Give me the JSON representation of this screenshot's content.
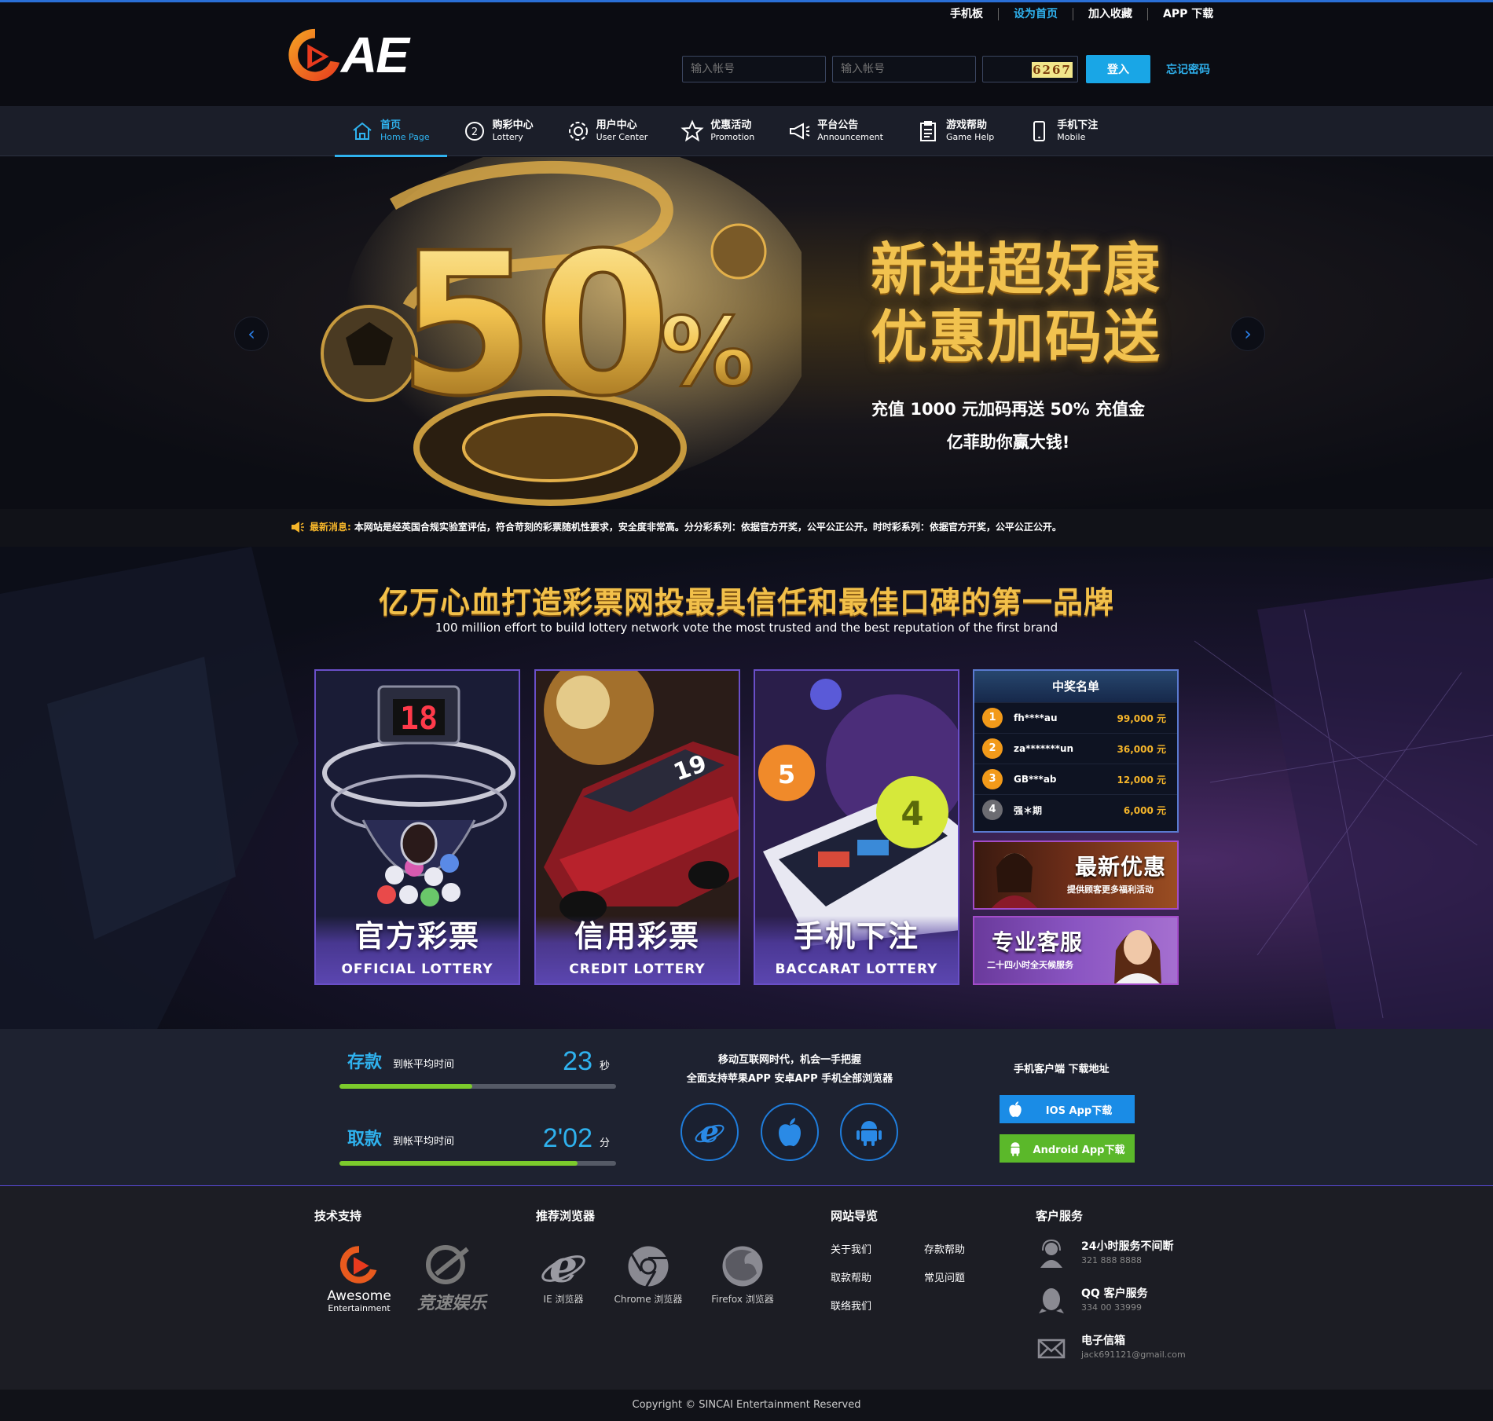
{
  "top_links": [
    "手机板",
    "设为首页",
    "加入收藏",
    "APP 下载"
  ],
  "brand": {
    "logo_text": "AE"
  },
  "login": {
    "account_placeholder": "输入帐号",
    "password_placeholder": "输入帐号",
    "captcha": "6267",
    "submit_label": "登入",
    "forgot_label": "忘记密码"
  },
  "nav": [
    {
      "zh": "首页",
      "en": "Home Page",
      "icon": "home-icon",
      "active": true
    },
    {
      "zh": "购彩中心",
      "en": "Lottery",
      "icon": "lottery-icon"
    },
    {
      "zh": "用户中心",
      "en": "User Center",
      "icon": "gear-icon"
    },
    {
      "zh": "优惠活动",
      "en": "Promotion",
      "icon": "star-icon"
    },
    {
      "zh": "平台公告",
      "en": "Announcement",
      "icon": "megaphone-icon"
    },
    {
      "zh": "游戏帮助",
      "en": "Game Help",
      "icon": "clipboard-icon"
    },
    {
      "zh": "手机下注",
      "en": "Mobile",
      "icon": "phone-icon"
    }
  ],
  "banner": {
    "big_number": "50",
    "percent": "%",
    "title_line1": "新进超好康",
    "title_line2": "优惠加码送",
    "sub_line1": "充值 1000 元加码再送 50% 充值金",
    "sub_line2": "亿菲助你赢大钱!"
  },
  "news": {
    "label": "最新消息:",
    "text": "本网站是经英国合规实验室评估，符合苛刻的彩票随机性要求，安全度非常高。分分彩系列：依据官方开奖，公平公正公开。时时彩系列：依据官方开奖，公平公正公开。"
  },
  "headline": {
    "zh": "亿万心血打造彩票网投最具信任和最佳口碑的第一品牌",
    "en": "100 million effort to build lottery network vote the most trusted and the best reputation of the first brand"
  },
  "cards": [
    {
      "zh": "官方彩票",
      "en": "OFFICIAL  LOTTERY",
      "display": "18"
    },
    {
      "zh": "信用彩票",
      "en": "CREDIT  LOTTERY"
    },
    {
      "zh": "手机下注",
      "en": "BACCARAT  LOTTERY"
    }
  ],
  "winners": {
    "title": "中奖名单",
    "rows": [
      {
        "rank": "1",
        "name": "fh****au",
        "amount": "99,000 元"
      },
      {
        "rank": "2",
        "name": "za*******un",
        "amount": "36,000 元"
      },
      {
        "rank": "3",
        "name": "GB***ab",
        "amount": "12,000 元"
      },
      {
        "rank": "4",
        "name": "强＊期",
        "amount": "6,000 元"
      }
    ]
  },
  "promos": [
    {
      "title": "最新优惠",
      "sub": "提供顾客更多福利活动"
    },
    {
      "title": "专业客服",
      "sub": "二十四小时全天候服务"
    }
  ],
  "stats": [
    {
      "title": "存款",
      "label": "到帐平均时间",
      "value": "23",
      "unit": "秒",
      "progress": 0.48
    },
    {
      "title": "取款",
      "label": "到帐平均时间",
      "value": "2'02",
      "unit": "分",
      "progress": 0.86
    }
  ],
  "mobile": {
    "line1": "移动互联网时代，机会一手把握",
    "line2": "全面支持苹果APP 安卓APP 手机全部浏览器"
  },
  "download": {
    "title": "手机客户端  下载地址",
    "ios": "IOS App下载",
    "android": "Android App下载"
  },
  "footer": {
    "tech_title": "技术支持",
    "tech_logos": [
      "Awesome",
      "Entertainment",
      "竞速娱乐"
    ],
    "browser_title": "推荐浏览器",
    "browsers": [
      "IE 浏览器",
      "Chrome 浏览器",
      "Firefox 浏览器"
    ],
    "nav_title": "网站导览",
    "nav_links": [
      "关于我们",
      "存款帮助",
      "取款帮助",
      "常见问题",
      "联络我们"
    ],
    "cs_title": "客户服务",
    "cs": [
      {
        "title": "24小时服务不间断",
        "sub": "321 888 8888",
        "icon": "user-headset-icon"
      },
      {
        "title": "QQ 客户服务",
        "sub": "334 00 33999",
        "icon": "qq-icon"
      },
      {
        "title": "电子信箱",
        "sub": "jack691121@gmail.com",
        "icon": "mail-icon"
      }
    ]
  },
  "copyright": "Copyright © SINCAI Entertainment Reserved",
  "colors": {
    "accent": "#2fb2ee",
    "gold": "#f2c04a",
    "purple_border": "#6a4fc8",
    "progress": "#7ccb2c"
  }
}
